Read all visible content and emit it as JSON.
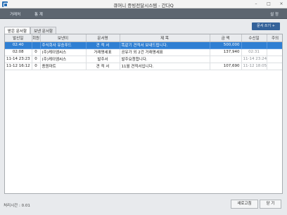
{
  "window": {
    "title": "큐머니 증빙전달시스템 - 간다Q",
    "btn_min": "–",
    "btn_max": "□",
    "btn_close": "×"
  },
  "menu": {
    "address": "거래처",
    "stats": "통 계",
    "settings": "설 정"
  },
  "tabs": [
    {
      "label": "받은 문서함",
      "active": true
    },
    {
      "label": "보낸 문서함",
      "active": false
    }
  ],
  "send_button": "문서 쓰기 +",
  "table": {
    "columns": [
      "발신일",
      "회원",
      "보낸이",
      "문서명",
      "제 목",
      "금 액",
      "수신일",
      "주의"
    ],
    "rows": [
      {
        "sent": "02:40",
        "member": "",
        "sender": "주식회사 유승푸드",
        "doc": "견 적 서",
        "subject": "똑같기 견적서 보내드립니다.",
        "amount": "500,000",
        "received": "",
        "note": "",
        "selected": true
      },
      {
        "sent": "02:08",
        "member": "0",
        "sender": "(주)케이엠씨스",
        "doc": "거래명세표",
        "subject": "공유가 외 2건 거래명세표",
        "amount": "137,940",
        "received": "02:31",
        "note": "",
        "selected": false
      },
      {
        "sent": "11-14 23:23",
        "member": "0",
        "sender": "(주)케이엠씨스",
        "doc": "발주서",
        "subject": "발주요청합니다.",
        "amount": "",
        "received": "11-14 23:24",
        "note": "",
        "selected": false
      },
      {
        "sent": "11-12 16:12",
        "member": "0",
        "sender": "종원마트",
        "doc": "견 적 서",
        "subject": "11월 견적서입니다.",
        "amount": "107,690",
        "received": "11-12 18:05",
        "note": "",
        "selected": false
      }
    ]
  },
  "status": {
    "label": "처리시간 : 0.01"
  },
  "buttons": {
    "refresh": "새로고침",
    "close": "닫 기"
  }
}
